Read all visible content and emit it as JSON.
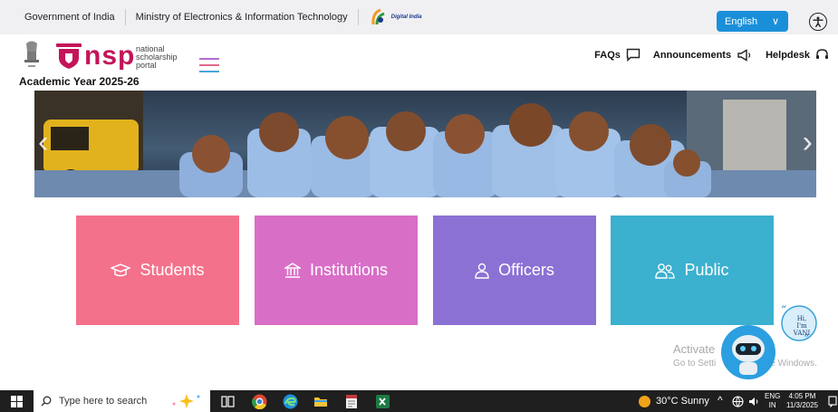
{
  "topbar": {
    "gov": "Government of India",
    "ministry": "Ministry of Electronics & Information Technology",
    "digital_india": "Digital India",
    "language": "English"
  },
  "header": {
    "brand_word": "nsp",
    "brand_sub_1": "national",
    "brand_sub_2": "scholarship",
    "brand_sub_3": "portal",
    "academic_year": "Academic Year 2025-26",
    "faqs": "FAQs",
    "announcements": "Announcements",
    "helpdesk": "Helpdesk"
  },
  "tiles": [
    {
      "label": "Students",
      "color": "#f4718b"
    },
    {
      "label": "Institutions",
      "color": "#d96ec7"
    },
    {
      "label": "Officers",
      "color": "#8b71d4"
    },
    {
      "label": "Public",
      "color": "#3bb0cf"
    }
  ],
  "chatbot": {
    "greeting_1": "Hi,",
    "greeting_2": "I'm VANI"
  },
  "watermark": {
    "line1": "Activate",
    "line2": "Go to Setti",
    "line3": "e Windows."
  },
  "taskbar": {
    "search_placeholder": "Type here to search",
    "weather": "30°C  Sunny",
    "lang_1": "ENG",
    "lang_2": "IN",
    "time": "4:05 PM",
    "date": "11/3/2025"
  },
  "colors": {
    "accent": "#1a8fd9",
    "brand": "#c4145a"
  }
}
